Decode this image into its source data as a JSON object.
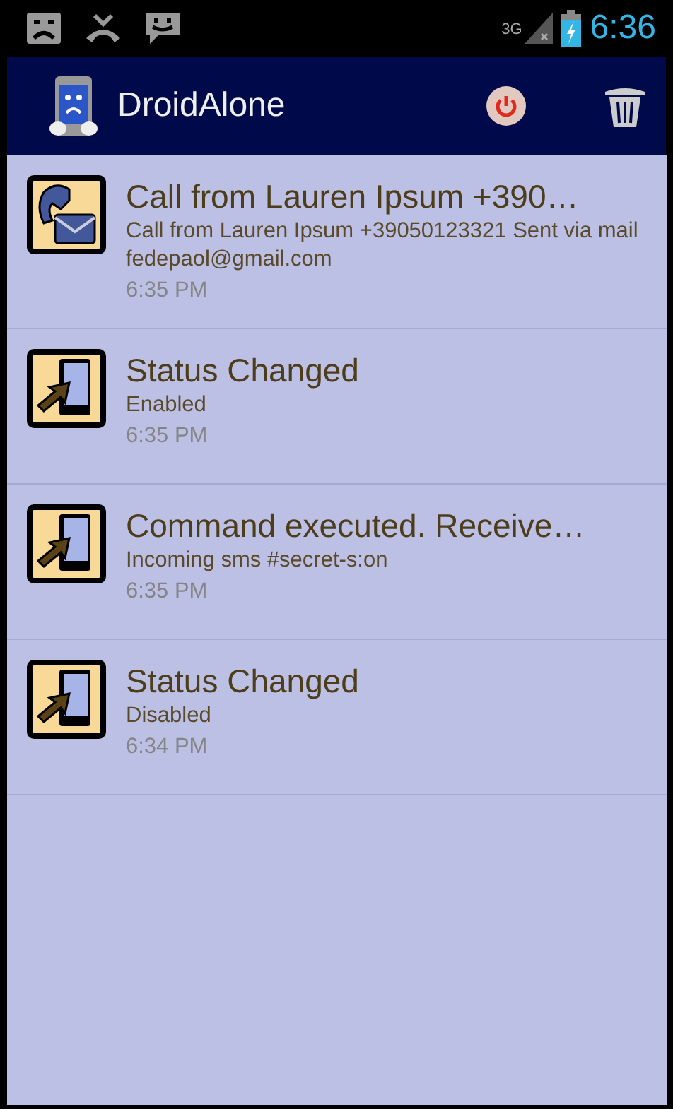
{
  "status_bar": {
    "network": "3G",
    "time": "6:36"
  },
  "action_bar": {
    "title": "DroidAlone"
  },
  "log": [
    {
      "kind": "call-mail",
      "title": "Call from Lauren Ipsum +390…",
      "detail": "Call from Lauren Ipsum +39050123321  Sent via mail fedepaol@gmail.com",
      "time": "6:35 PM"
    },
    {
      "kind": "status",
      "title": "Status Changed",
      "detail": "Enabled",
      "time": "6:35 PM"
    },
    {
      "kind": "status",
      "title": "Command executed. Receive…",
      "detail": "Incoming sms #secret-s:on",
      "time": "6:35 PM"
    },
    {
      "kind": "status",
      "title": "Status Changed",
      "detail": "Disabled",
      "time": "6:34 PM"
    }
  ]
}
